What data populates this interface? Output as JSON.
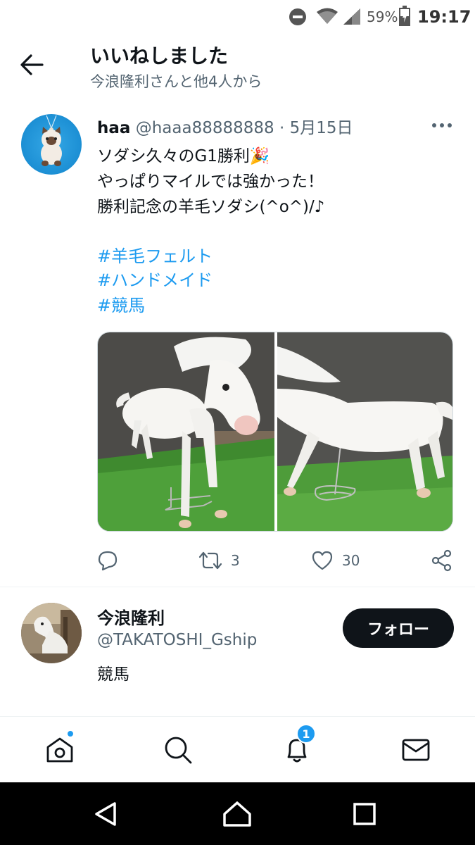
{
  "status_bar": {
    "battery": "59%",
    "time": "19:17",
    "icons": [
      "dnd-icon",
      "wifi-icon",
      "signal-icon",
      "battery-icon"
    ]
  },
  "header": {
    "title": "いいねしました",
    "subtitle": "今浪隆利さんと他4人から",
    "back_icon": "arrow-left-icon"
  },
  "tweet": {
    "name": "haa",
    "handle": "@haaa88888888",
    "separator": "·",
    "date": "5月15日",
    "lines": [
      "ソダシ久々のG1勝利🎉",
      "やっぱりマイルでは強かった！",
      "勝利記念の羊毛ソダシ(^o^)/♪"
    ],
    "hashtags": [
      "#羊毛フェルト",
      "#ハンドメイド",
      "#競馬"
    ],
    "actions": {
      "reply_count": "",
      "retweet_count": "3",
      "like_count": "30",
      "share_count": ""
    }
  },
  "user": {
    "name": "今浪隆利",
    "handle": "@TAKATOSHI_Gship",
    "bio": "競馬",
    "follow_label": "フォロー"
  },
  "bottom_nav": {
    "notification_badge": "1",
    "items": [
      "home-icon",
      "search-icon",
      "notifications-icon",
      "messages-icon"
    ]
  },
  "colors": {
    "accent": "#1d9bf0",
    "text": "#0f1419",
    "secondary": "#536471",
    "follow_bg": "#0f1419"
  }
}
